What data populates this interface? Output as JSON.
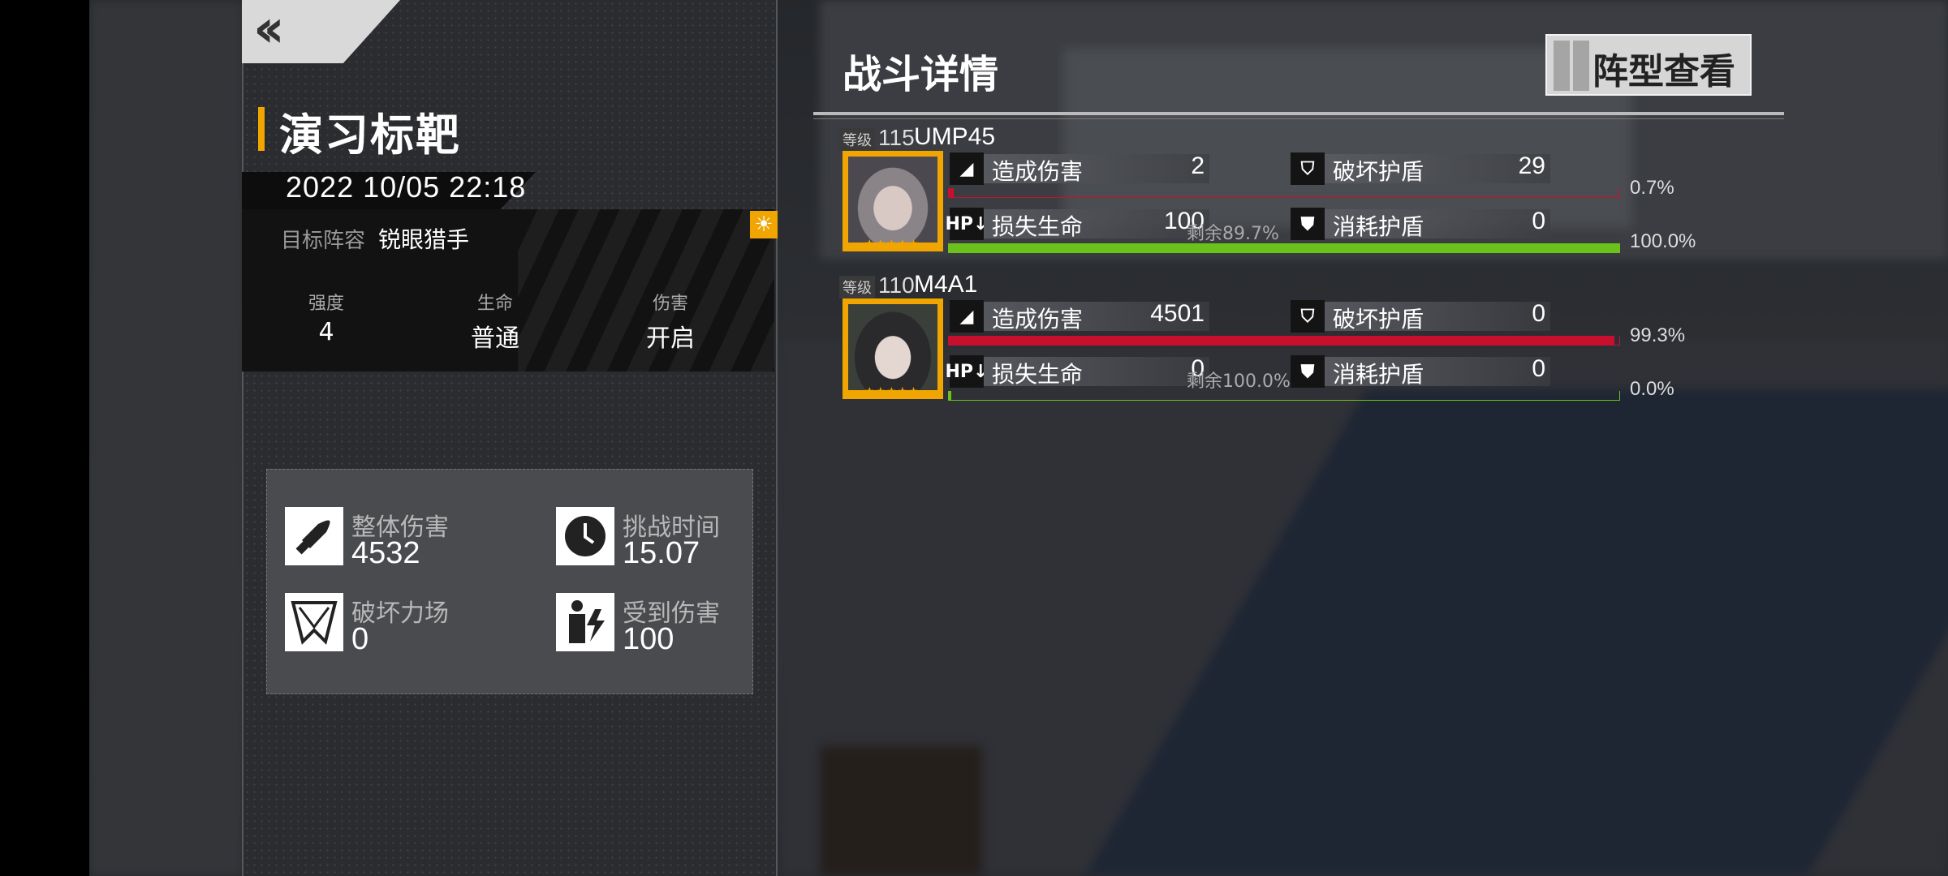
{
  "back": {
    "icon": "double-chevron-left-icon"
  },
  "left": {
    "title": "演习标靶",
    "date": "2022 10/05 22:18",
    "lineup_label": "目标阵容",
    "lineup_value": "锐眼猎手",
    "attrs": [
      {
        "label": "强度",
        "value": "4"
      },
      {
        "label": "生命",
        "value": "普通"
      },
      {
        "label": "伤害",
        "value": "开启"
      }
    ],
    "summary": [
      {
        "label": "整体伤害",
        "value": "4532",
        "icon": "bullet-icon"
      },
      {
        "label": "挑战时间",
        "value": "15.07",
        "icon": "clock-icon"
      },
      {
        "label": "破坏力场",
        "value": "0",
        "icon": "shattered-shield-icon"
      },
      {
        "label": "受到伤害",
        "value": "100",
        "icon": "hit-person-icon"
      }
    ]
  },
  "right": {
    "title": "战斗详情",
    "formation_button": "阵型查看",
    "level_label": "等级",
    "characters": [
      {
        "level": "115",
        "name": "UMP45",
        "damage_label": "造成伤害",
        "damage": "2",
        "shield_break_label": "破坏护盾",
        "shield_break": "29",
        "hp_lost_label": "损失生命",
        "hp_lost": "100",
        "remain": "剩余89.7%",
        "shield_used_label": "消耗护盾",
        "shield_used": "0",
        "damage_pct": "0.7%",
        "damage_frac": 0.007,
        "hp_pct": "100.0%",
        "hp_frac": 1.0
      },
      {
        "level": "110",
        "name": "M4A1",
        "damage_label": "造成伤害",
        "damage": "4501",
        "shield_break_label": "破坏护盾",
        "shield_break": "0",
        "hp_lost_label": "损失生命",
        "hp_lost": "0",
        "remain": "剩余100.0%",
        "shield_used_label": "消耗护盾",
        "shield_used": "0",
        "damage_pct": "99.3%",
        "damage_frac": 0.993,
        "hp_pct": "0.0%",
        "hp_frac": 0.0
      }
    ]
  },
  "colors": {
    "accent": "#f0a500",
    "damage_bar": "#c8102e",
    "hp_bar": "#6ac21a"
  }
}
